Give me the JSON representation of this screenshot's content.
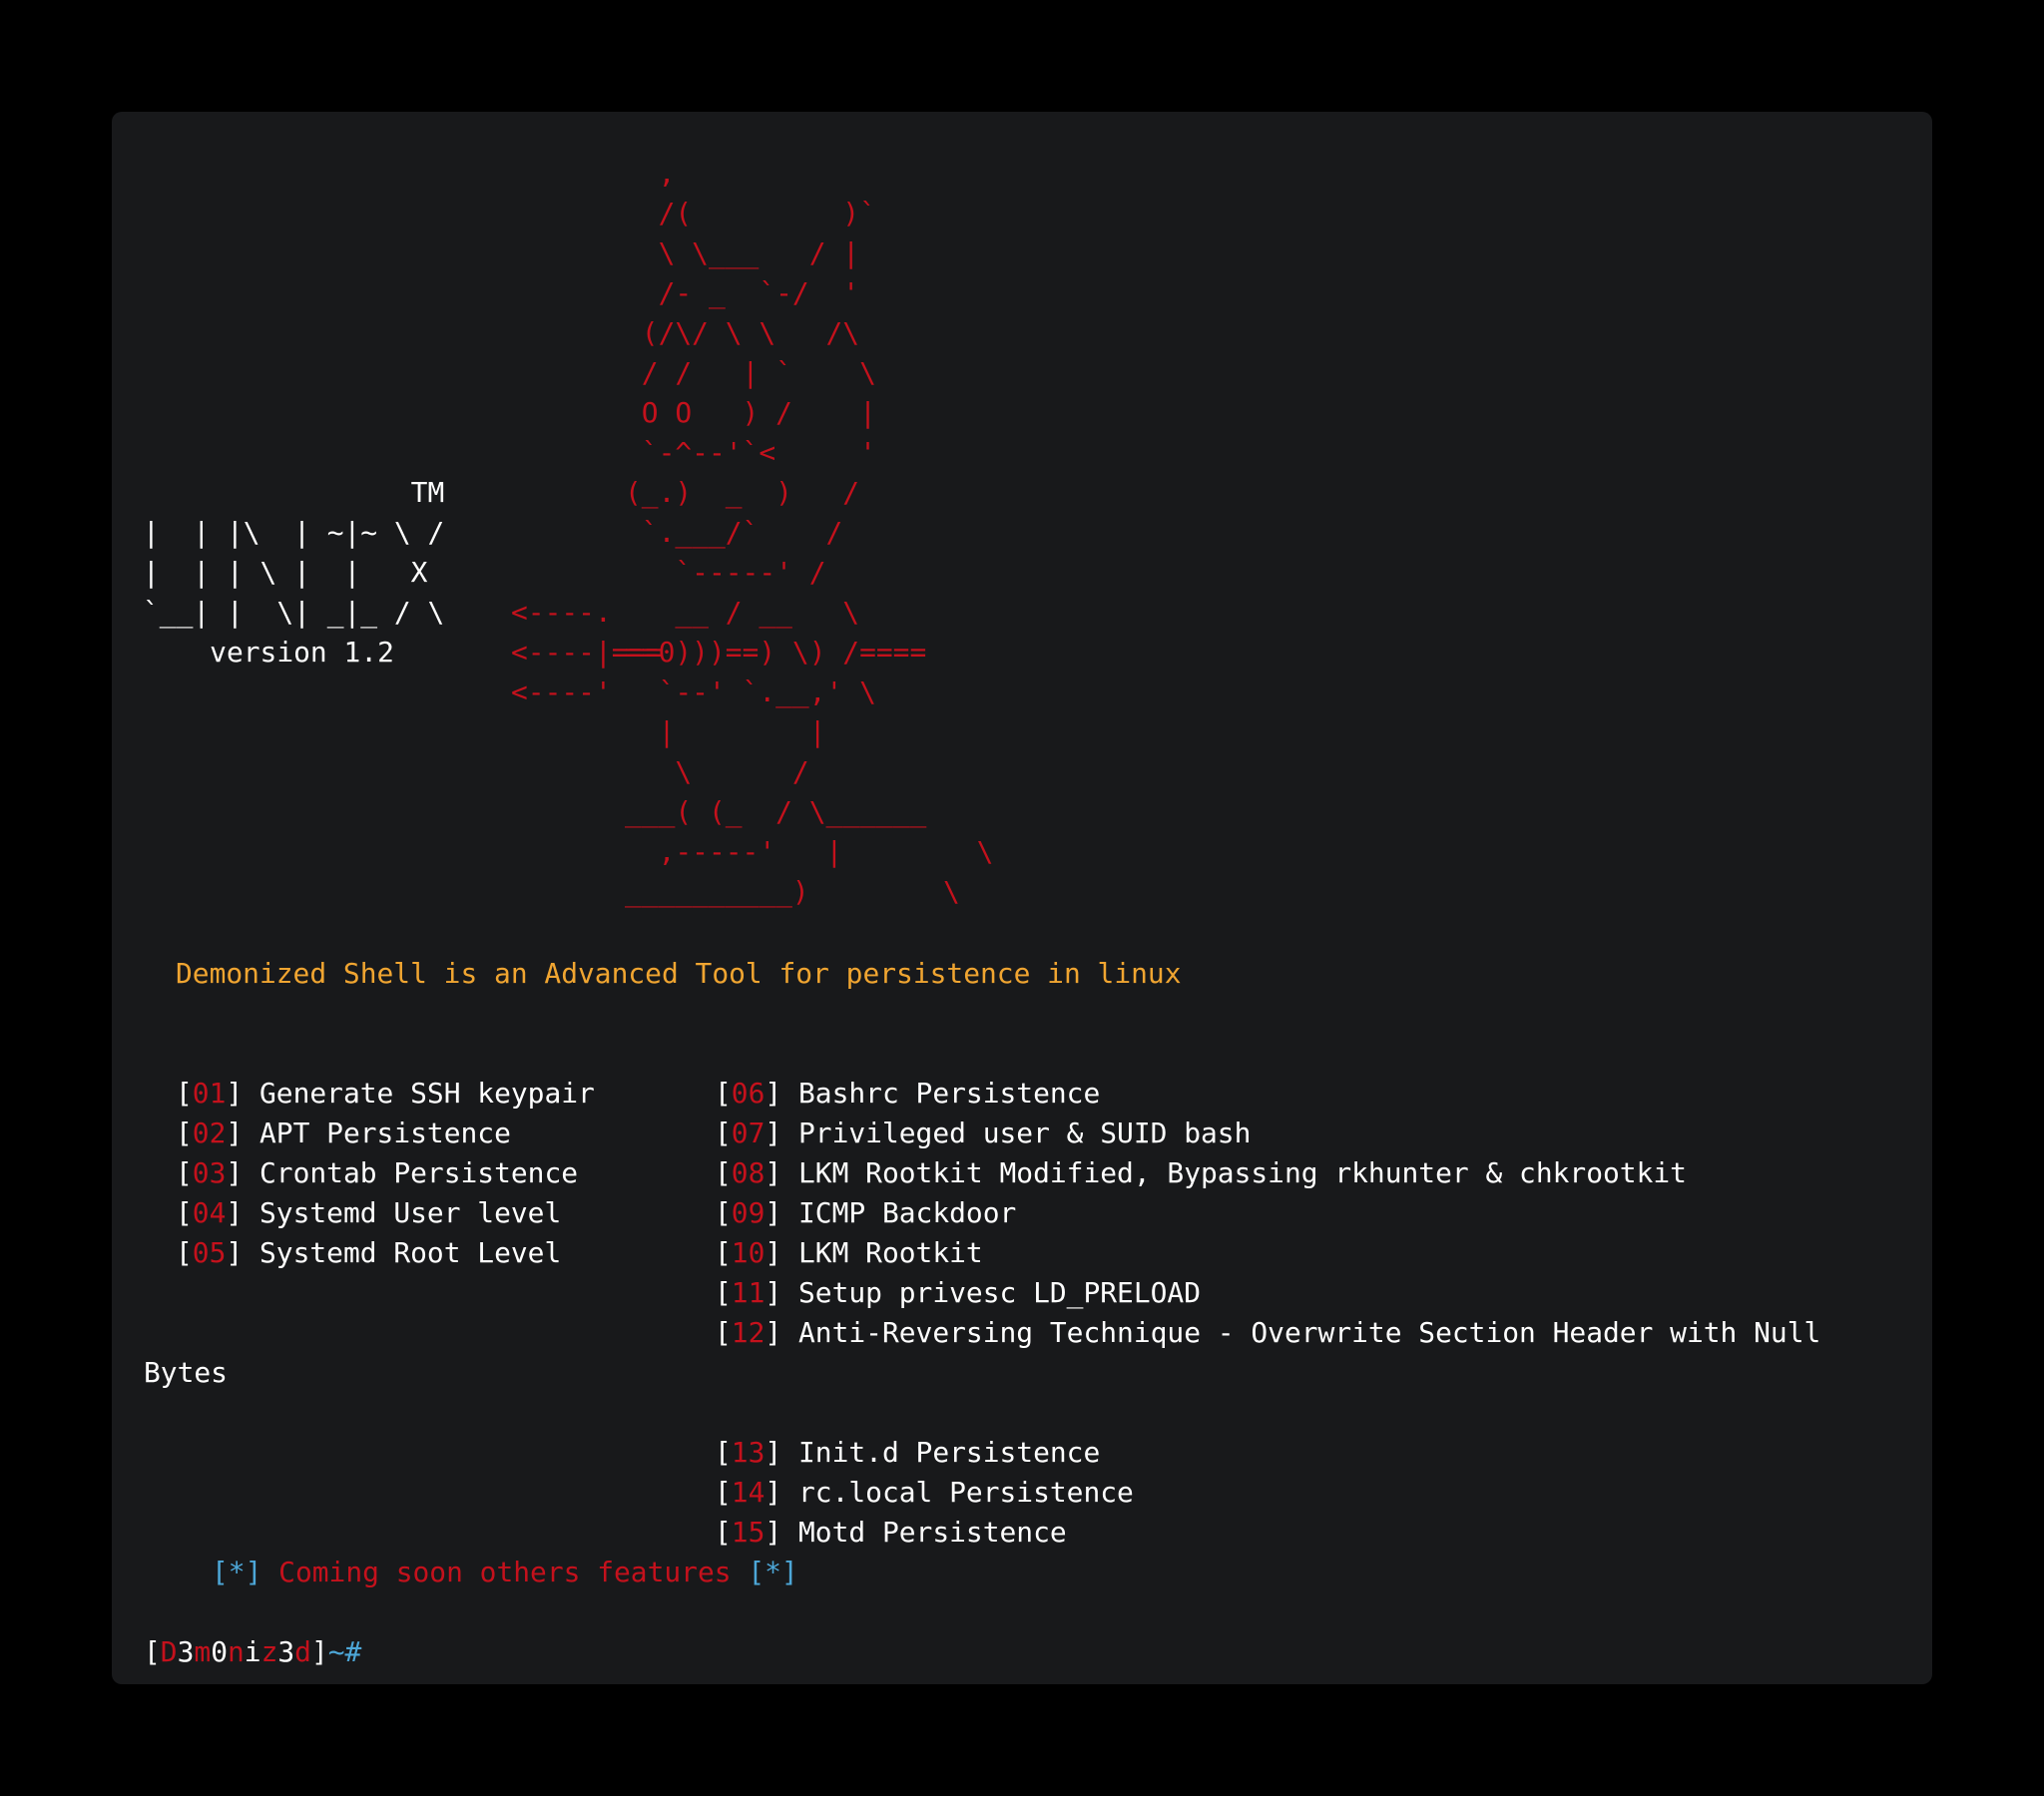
{
  "terminal": {
    "banner_art": "  ,\n  /(         )`\n  \\ \\___   / |\n  /- _  `-/  '\n (/\\/ \\ \\   /\\\n / /   | `    \\\n O O   ) /    |\n `-^--'`<     '\n(_.)  _  )   /\n `.___/`    /\n   `-----' /\n   __ / __   \\\n==0)))==) \\) /====\n  `--' `.__,' \\\n  |        |\n   \\      /\n___( (_  / \\______\n  ,-----'   |        \\\n__________)        \\",
    "logo_art": "                TM\n|  | |\\  | ~|~ \\ /\n|  | | \\ |  |   X\n`__| |  \\| _|_ / \\\n    version 1.2",
    "arrow_art": "<----.\n<----|===\n<----'",
    "tagline": "Demonized Shell is an Advanced Tool for persistence in linux",
    "menu_left": [
      {
        "num": "01",
        "label": "Generate SSH keypair"
      },
      {
        "num": "02",
        "label": "APT Persistence"
      },
      {
        "num": "03",
        "label": "Crontab Persistence"
      },
      {
        "num": "04",
        "label": "Systemd User level"
      },
      {
        "num": "05",
        "label": "Systemd Root Level"
      }
    ],
    "menu_right": [
      {
        "num": "06",
        "label": "Bashrc Persistence"
      },
      {
        "num": "07",
        "label": "Privileged user & SUID bash"
      },
      {
        "num": "08",
        "label": "LKM Rootkit Modified, Bypassing rkhunter & chkrootkit"
      },
      {
        "num": "09",
        "label": "ICMP Backdoor"
      },
      {
        "num": "10",
        "label": "LKM Rootkit"
      },
      {
        "num": "11",
        "label": "Setup privesc LD_PRELOAD"
      },
      {
        "num": "12",
        "label": "Anti-Reversing Technique - Overwrite Section Header with Null"
      },
      {
        "num": "13",
        "label": "Init.d Persistence"
      },
      {
        "num": "14",
        "label": "rc.local Persistence"
      },
      {
        "num": "15",
        "label": "Motd Persistence"
      }
    ],
    "wrap_tail": "Bytes",
    "coming_soon": {
      "star_open": "[*]",
      "text": "Coming soon others features",
      "star_close": "[*]"
    },
    "prompt": {
      "open": "[",
      "p1": "D",
      "p2": "3",
      "p3": "m",
      "p4": "0",
      "p5": "n",
      "p6": "i",
      "p7": "z",
      "p8": "3",
      "p9": "d",
      "close": "]",
      "suffix": "~#"
    }
  },
  "colors": {
    "background": "#000000",
    "terminal_bg": "#18191b",
    "red": "#c4111c",
    "orange": "#f0a531",
    "blue": "#4da7d8",
    "text": "#ffffff"
  }
}
